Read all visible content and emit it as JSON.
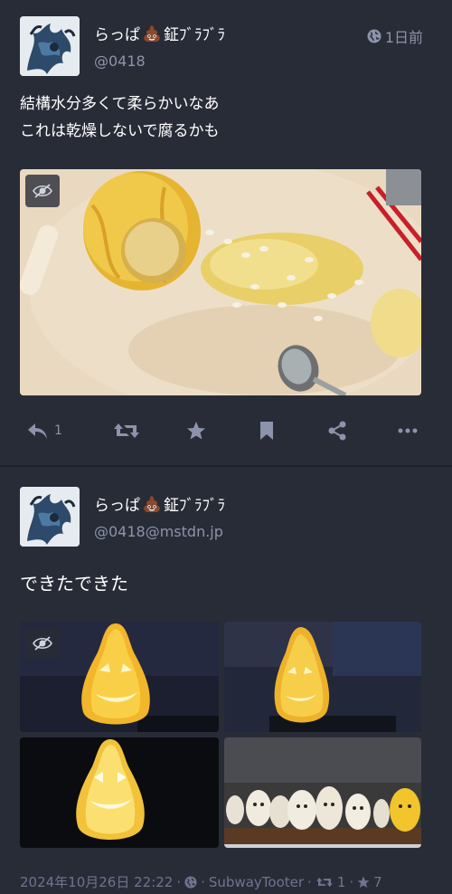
{
  "colors": {
    "background": "#282c37",
    "divider": "#1e2129",
    "icon": "#8d93ab",
    "text_secondary": "#8d93ab"
  },
  "status1": {
    "display_name_before": "らっぱ",
    "display_name_after": "鉦ﾌﾞﾗﾌﾞﾗ",
    "acct": "@0418",
    "time": "1日前",
    "visibility_icon": "globe-icon",
    "content_lines": [
      "結構水分多くて柔らかいなあ",
      "これは乾燥しないで腐るかも"
    ],
    "actions": {
      "reply_count": "1"
    }
  },
  "status2": {
    "display_name_before": "らっぱ",
    "display_name_after": "鉦ﾌﾞﾗﾌﾞﾗ",
    "acct": "@0418@mstdn.jp",
    "content": "できたできた",
    "footer": {
      "datetime": "2024年10月26日 22:22",
      "separator": "·",
      "client": "SubwayTooter",
      "boost_count": "1",
      "fav_count": "7"
    }
  }
}
